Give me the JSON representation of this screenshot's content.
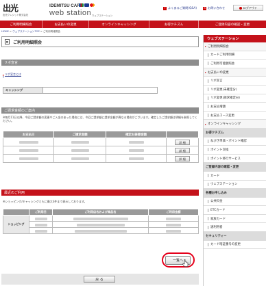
{
  "header": {
    "logo_kanji": "出光",
    "logo_subtitle": "出光クレジット株式会社",
    "brand_card": "IDEMITSU CARD",
    "brand_ws": "web station",
    "brand_ws_jp": "ウェブステーション",
    "links": [
      {
        "label": "よくあるご質問(Q&A)"
      },
      {
        "label": "お問い合わせ"
      }
    ],
    "logout_label": "ログアウト"
  },
  "top_nav": [
    "ご利用明細照会",
    "お支払いの変更",
    "オンラインキャッシング",
    "お得クチズム",
    "ご登録内容の確認・変更"
  ],
  "breadcrumb": {
    "home": "HOME",
    "sep": " > ",
    "top": "ウェブステーションTOP",
    "current": "ご利用明細照会"
  },
  "main": {
    "page_title": "ご利用明細照会",
    "revo": {
      "heading": "リボ宣言",
      "link": "リボ宣言とは",
      "row_label": "キャッシング"
    },
    "billing": {
      "heading": "ご請求金額のご案内",
      "note": "※毎月11日以降、今回ご請求額の変更やご入金のあった場合には、今回ご請求額に請求金額が異なる場合がございます。確定したご請求額は明細を参照してください。",
      "columns": [
        "お支払日",
        "ご請求金額",
        "確定お振替金額",
        ""
      ],
      "rows": [
        {
          "detail": "詳 細"
        },
        {
          "detail": "詳 細"
        },
        {
          "detail": "詳 細"
        }
      ]
    },
    "recent": {
      "heading": "最近のご利用",
      "note": "※ショッピング/キャッシングともに最大3件まで表示しております。",
      "columns": [
        "",
        "ご利用日",
        "ご利用店名および商品名",
        "ご利用金額"
      ],
      "category": "ショッピング",
      "list_button": "一覧へ"
    },
    "back_button": "戻 る"
  },
  "sidebar": {
    "title": "ウェブステーション",
    "items": [
      {
        "label": "ご利用明細照会",
        "level": 1
      },
      {
        "label": "カードご利用明細",
        "level": 2
      },
      {
        "label": "ご利用可能額照会",
        "level": 2
      },
      {
        "label": "お支払いの変更",
        "level": 1
      },
      {
        "label": "リボ宣言",
        "level": 2
      },
      {
        "label": "リボ変更(未確定分)",
        "level": 2
      },
      {
        "label": "リボ変更(請求確定分)",
        "level": 2
      },
      {
        "label": "お支払増額",
        "level": 2
      },
      {
        "label": "お支払コース変更",
        "level": 2
      },
      {
        "label": "オンラインキャッシング",
        "level": 1
      },
      {
        "label": "お得クチズム",
        "level": 0
      },
      {
        "label": "ねびき単価・ポイント確認",
        "level": 2
      },
      {
        "label": "ポイント交換",
        "level": 2
      },
      {
        "label": "ポイント移行サービス",
        "level": 2
      },
      {
        "label": "ご登録内容の確認・変更",
        "level": 0
      },
      {
        "label": "カード",
        "level": 2
      },
      {
        "label": "ウェブステーション",
        "level": 2
      },
      {
        "label": "各種お申し込み",
        "level": 0
      },
      {
        "label": "公共料金",
        "level": 2
      },
      {
        "label": "ETCカード",
        "level": 2
      },
      {
        "label": "家族カード",
        "level": 2
      },
      {
        "label": "遠利用者",
        "level": 2
      },
      {
        "label": "セキュリティー",
        "level": 0
      },
      {
        "label": "カード暗証番号の変更",
        "level": 2
      }
    ]
  },
  "colors": {
    "brand_red": "#c4121a",
    "section_gray": "#8d8d8d",
    "link_blue": "#2a3b8f"
  }
}
